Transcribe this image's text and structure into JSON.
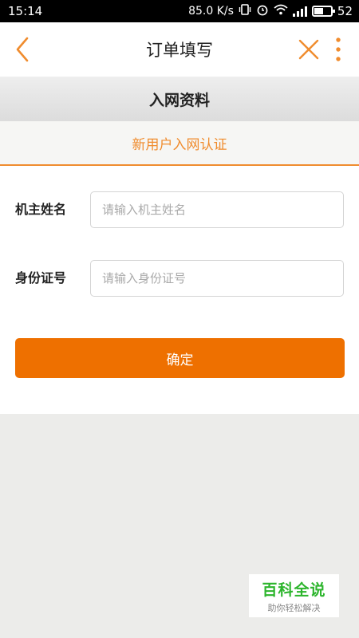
{
  "status_bar": {
    "time": "15:14",
    "net_speed": "85.0 K/s",
    "battery": "52"
  },
  "header": {
    "title": "订单填写"
  },
  "section": {
    "title": "入网资料"
  },
  "tab": {
    "label": "新用户入网认证"
  },
  "form": {
    "owner_name_label": "机主姓名",
    "owner_name_placeholder": "请输入机主姓名",
    "owner_name_value": "",
    "id_number_label": "身份证号",
    "id_number_placeholder": "请输入身份证号",
    "id_number_value": "",
    "confirm_label": "确定"
  },
  "watermark": {
    "main": "百科全说",
    "sub": "助你轻松解决"
  },
  "colors": {
    "accent": "#ee7000",
    "tab_text": "#f08c2e",
    "watermark_green": "#2db52d"
  }
}
